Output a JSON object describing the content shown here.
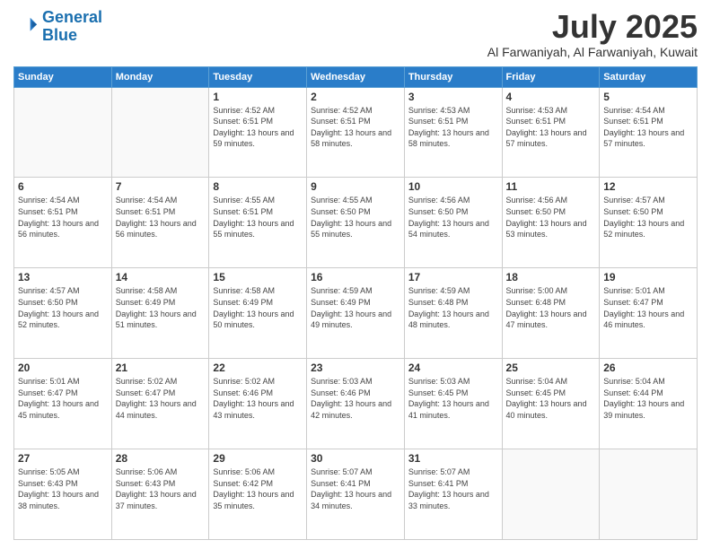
{
  "header": {
    "logo_line1": "General",
    "logo_line2": "Blue",
    "month": "July 2025",
    "location": "Al Farwaniyah, Al Farwaniyah, Kuwait"
  },
  "weekdays": [
    "Sunday",
    "Monday",
    "Tuesday",
    "Wednesday",
    "Thursday",
    "Friday",
    "Saturday"
  ],
  "weeks": [
    [
      {
        "day": "",
        "info": ""
      },
      {
        "day": "",
        "info": ""
      },
      {
        "day": "1",
        "info": "Sunrise: 4:52 AM\nSunset: 6:51 PM\nDaylight: 13 hours and 59 minutes."
      },
      {
        "day": "2",
        "info": "Sunrise: 4:52 AM\nSunset: 6:51 PM\nDaylight: 13 hours and 58 minutes."
      },
      {
        "day": "3",
        "info": "Sunrise: 4:53 AM\nSunset: 6:51 PM\nDaylight: 13 hours and 58 minutes."
      },
      {
        "day": "4",
        "info": "Sunrise: 4:53 AM\nSunset: 6:51 PM\nDaylight: 13 hours and 57 minutes."
      },
      {
        "day": "5",
        "info": "Sunrise: 4:54 AM\nSunset: 6:51 PM\nDaylight: 13 hours and 57 minutes."
      }
    ],
    [
      {
        "day": "6",
        "info": "Sunrise: 4:54 AM\nSunset: 6:51 PM\nDaylight: 13 hours and 56 minutes."
      },
      {
        "day": "7",
        "info": "Sunrise: 4:54 AM\nSunset: 6:51 PM\nDaylight: 13 hours and 56 minutes."
      },
      {
        "day": "8",
        "info": "Sunrise: 4:55 AM\nSunset: 6:51 PM\nDaylight: 13 hours and 55 minutes."
      },
      {
        "day": "9",
        "info": "Sunrise: 4:55 AM\nSunset: 6:50 PM\nDaylight: 13 hours and 55 minutes."
      },
      {
        "day": "10",
        "info": "Sunrise: 4:56 AM\nSunset: 6:50 PM\nDaylight: 13 hours and 54 minutes."
      },
      {
        "day": "11",
        "info": "Sunrise: 4:56 AM\nSunset: 6:50 PM\nDaylight: 13 hours and 53 minutes."
      },
      {
        "day": "12",
        "info": "Sunrise: 4:57 AM\nSunset: 6:50 PM\nDaylight: 13 hours and 52 minutes."
      }
    ],
    [
      {
        "day": "13",
        "info": "Sunrise: 4:57 AM\nSunset: 6:50 PM\nDaylight: 13 hours and 52 minutes."
      },
      {
        "day": "14",
        "info": "Sunrise: 4:58 AM\nSunset: 6:49 PM\nDaylight: 13 hours and 51 minutes."
      },
      {
        "day": "15",
        "info": "Sunrise: 4:58 AM\nSunset: 6:49 PM\nDaylight: 13 hours and 50 minutes."
      },
      {
        "day": "16",
        "info": "Sunrise: 4:59 AM\nSunset: 6:49 PM\nDaylight: 13 hours and 49 minutes."
      },
      {
        "day": "17",
        "info": "Sunrise: 4:59 AM\nSunset: 6:48 PM\nDaylight: 13 hours and 48 minutes."
      },
      {
        "day": "18",
        "info": "Sunrise: 5:00 AM\nSunset: 6:48 PM\nDaylight: 13 hours and 47 minutes."
      },
      {
        "day": "19",
        "info": "Sunrise: 5:01 AM\nSunset: 6:47 PM\nDaylight: 13 hours and 46 minutes."
      }
    ],
    [
      {
        "day": "20",
        "info": "Sunrise: 5:01 AM\nSunset: 6:47 PM\nDaylight: 13 hours and 45 minutes."
      },
      {
        "day": "21",
        "info": "Sunrise: 5:02 AM\nSunset: 6:47 PM\nDaylight: 13 hours and 44 minutes."
      },
      {
        "day": "22",
        "info": "Sunrise: 5:02 AM\nSunset: 6:46 PM\nDaylight: 13 hours and 43 minutes."
      },
      {
        "day": "23",
        "info": "Sunrise: 5:03 AM\nSunset: 6:46 PM\nDaylight: 13 hours and 42 minutes."
      },
      {
        "day": "24",
        "info": "Sunrise: 5:03 AM\nSunset: 6:45 PM\nDaylight: 13 hours and 41 minutes."
      },
      {
        "day": "25",
        "info": "Sunrise: 5:04 AM\nSunset: 6:45 PM\nDaylight: 13 hours and 40 minutes."
      },
      {
        "day": "26",
        "info": "Sunrise: 5:04 AM\nSunset: 6:44 PM\nDaylight: 13 hours and 39 minutes."
      }
    ],
    [
      {
        "day": "27",
        "info": "Sunrise: 5:05 AM\nSunset: 6:43 PM\nDaylight: 13 hours and 38 minutes."
      },
      {
        "day": "28",
        "info": "Sunrise: 5:06 AM\nSunset: 6:43 PM\nDaylight: 13 hours and 37 minutes."
      },
      {
        "day": "29",
        "info": "Sunrise: 5:06 AM\nSunset: 6:42 PM\nDaylight: 13 hours and 35 minutes."
      },
      {
        "day": "30",
        "info": "Sunrise: 5:07 AM\nSunset: 6:41 PM\nDaylight: 13 hours and 34 minutes."
      },
      {
        "day": "31",
        "info": "Sunrise: 5:07 AM\nSunset: 6:41 PM\nDaylight: 13 hours and 33 minutes."
      },
      {
        "day": "",
        "info": ""
      },
      {
        "day": "",
        "info": ""
      }
    ]
  ]
}
